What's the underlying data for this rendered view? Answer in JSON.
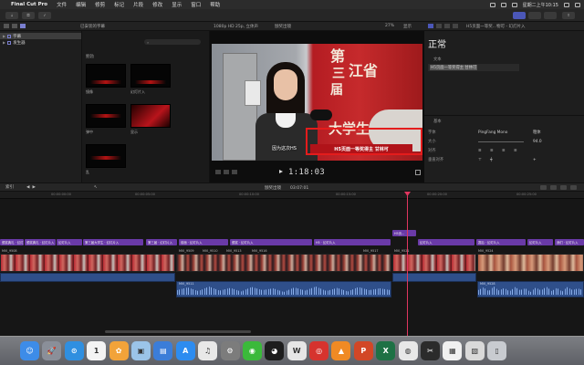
{
  "menubar": {
    "apple": "",
    "app_name": "Final Cut Pro",
    "items": [
      "文件",
      "编辑",
      "修剪",
      "标记",
      "片段",
      "修改",
      "显示",
      "窗口",
      "帮助"
    ],
    "clock": "星期二上午10:15"
  },
  "browser": {
    "header": "已安装的字幕",
    "search_placeholder": "",
    "sidebar": [
      {
        "label": "字幕",
        "selected": true
      },
      {
        "label": "发生器",
        "selected": false
      }
    ],
    "section": "鲍勃",
    "thumbs": [
      {
        "label": "镜像",
        "style": "dark"
      },
      {
        "label": "幻灯片入",
        "style": "dark"
      },
      {
        "label": "弹中",
        "style": "dark"
      },
      {
        "label": "显示",
        "style": "red"
      },
      {
        "label": "乱",
        "style": "dark"
      }
    ]
  },
  "viewer": {
    "format": "1080p HD 25p, 立体声",
    "project": "颁奖出镜",
    "zoom": "27%",
    "view_label": "显示",
    "timecode": "1:18:03",
    "frame_text": {
      "big1": "第",
      "big2": "江省",
      "big3": "三",
      "big4": "届",
      "bottom": "大学生",
      "subtitle": "因为这次HS",
      "lower_third": "H5页面一等奖得主 甘林可"
    }
  },
  "inspector": {
    "clip_title": "H5页面一等奖...物可 - 幻灯片入",
    "heading": "正常",
    "text_label": "文本",
    "text_value": "H5页面一等奖得主 甘林可",
    "basic_label": "基本",
    "rows": [
      {
        "label": "字体",
        "value": "PingFang Mono",
        "value2": "粗体"
      },
      {
        "label": "大小",
        "value": "",
        "value2": "94.0"
      },
      {
        "label": "对齐",
        "value": "",
        "value2": ""
      },
      {
        "label": "垂直对齐",
        "value": "",
        "value2": ""
      }
    ]
  },
  "timeline": {
    "index_label": "索引",
    "project_name": "颁奖出镜",
    "duration": "03:07:01",
    "ruler": [
      "00:00:00:00",
      "00:00:05:00",
      "00:00:10:00",
      "00:00:15:00",
      "00:00:20:00",
      "00:00:25:00",
      "00:00:30:00"
    ],
    "connected_title": "H5页...",
    "title_clips_row1": [
      "颁奖典礼 · 幻灯片入",
      "颁奖典礼 · 幻灯片入",
      "幻灯片入",
      "第三届大学生 · 幻灯片入",
      "第三届 · 幻灯片入",
      "前面 · 幻灯片入",
      "颁奖 · 幻灯片入",
      "H5 · 幻灯片入"
    ],
    "title_clips_row2": [
      "幻灯片入",
      "赛后 · 幻灯片入",
      "幻灯片入",
      "我们 · 幻灯片入",
      "幻灯片入",
      "他们 · 幻灯片入"
    ],
    "video_labels": [
      "MVI_9508",
      "MVI_9509",
      "MVI_9510",
      "MVI_9513",
      "MVI_9516",
      "MVI_9517",
      "MVI_9521",
      "MVI_9524"
    ],
    "audio_labels": [
      "MVI_9511",
      "MVI_9528"
    ]
  },
  "dock": {
    "apps": [
      {
        "name": "finder",
        "glyph": "☺",
        "color": "#3d8ce8"
      },
      {
        "name": "launchpad",
        "glyph": "🚀",
        "color": "#8a8f99"
      },
      {
        "name": "safari",
        "glyph": "⊙",
        "color": "#2f8fe0"
      },
      {
        "name": "calendar",
        "glyph": "1",
        "color": "#f4f4f4"
      },
      {
        "name": "photos",
        "glyph": "✿",
        "color": "#f2a33a"
      },
      {
        "name": "preview",
        "glyph": "▣",
        "color": "#9bc4e8"
      },
      {
        "name": "keynote",
        "glyph": "▤",
        "color": "#3b7dd8"
      },
      {
        "name": "app-store",
        "glyph": "A",
        "color": "#2d8cf0"
      },
      {
        "name": "music",
        "glyph": "♫",
        "color": "#e8e8e8"
      },
      {
        "name": "system-prefs",
        "glyph": "⚙",
        "color": "#7c7c7c"
      },
      {
        "name": "wechat",
        "glyph": "◉",
        "color": "#3bb93b"
      },
      {
        "name": "qq",
        "glyph": "◕",
        "color": "#1d1d1d"
      },
      {
        "name": "weibo",
        "glyph": "W",
        "color": "#e6e6e6"
      },
      {
        "name": "netease-music",
        "glyph": "◎",
        "color": "#d6332e"
      },
      {
        "name": "vlc",
        "glyph": "▲",
        "color": "#f08a24"
      },
      {
        "name": "powerpoint",
        "glyph": "P",
        "color": "#d24726"
      },
      {
        "name": "excel",
        "glyph": "X",
        "color": "#1e7145"
      },
      {
        "name": "chrome",
        "glyph": "◍",
        "color": "#e8e8e8"
      },
      {
        "name": "final-cut-pro",
        "glyph": "✂",
        "color": "#2b2b2b"
      },
      {
        "name": "textedit",
        "glyph": "▦",
        "color": "#f0f0f0"
      },
      {
        "name": "image-capture",
        "glyph": "▧",
        "color": "#d9d9d9"
      },
      {
        "name": "trash",
        "glyph": "▯",
        "color": "#c8cbd0"
      }
    ]
  }
}
